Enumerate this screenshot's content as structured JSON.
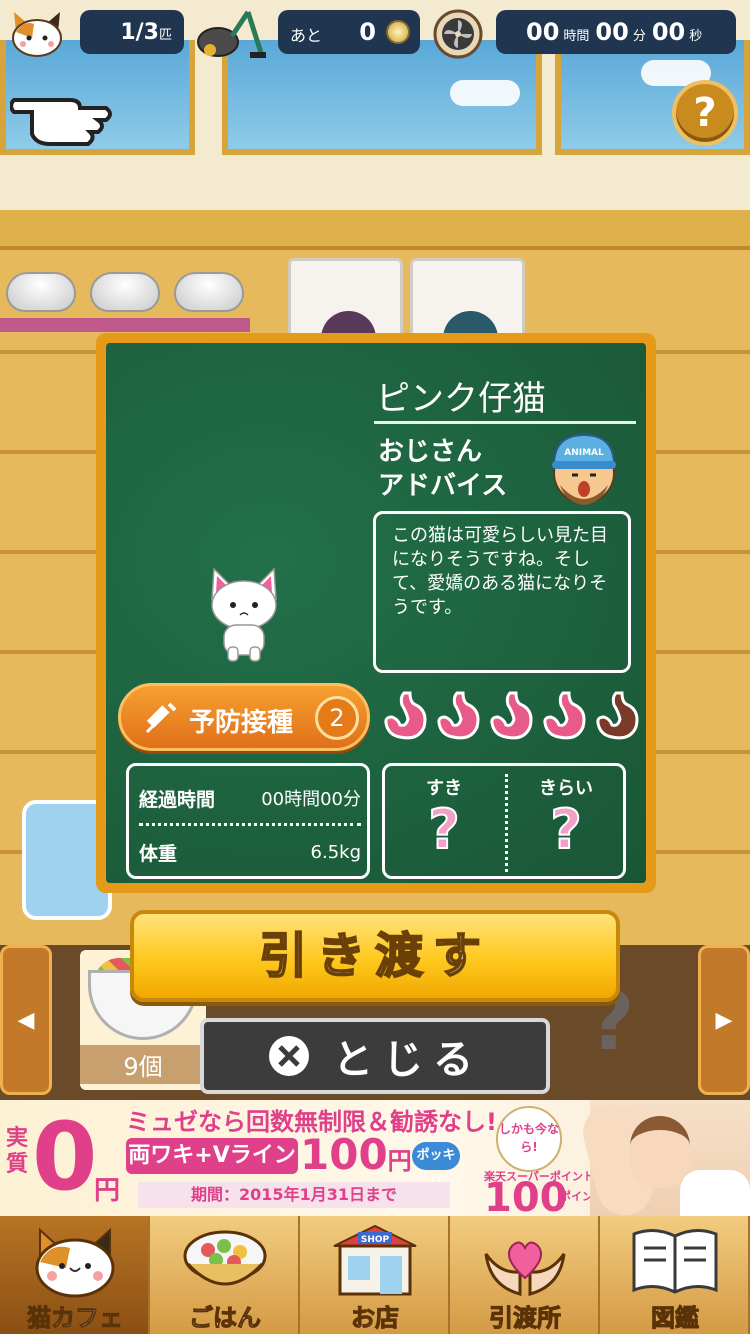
{
  "hud": {
    "cat_count": "1/3",
    "cat_count_unit": "匹",
    "coins_label": "あと",
    "coins_value": "0",
    "timer": {
      "hours": "00",
      "hours_unit": "時間",
      "minutes": "00",
      "minutes_unit": "分",
      "seconds": "00",
      "seconds_unit": "秒"
    },
    "help_label": "?"
  },
  "dialog": {
    "kitten_name": "ピンク仔猫",
    "advice_title_line1": "おじさん",
    "advice_title_line2": "アドバイス",
    "ojisan_cap_text": "ANIMAL",
    "advice_text": "この猫は可愛らしい見た目になりそうですね。そして、愛嬌のある猫になりそうです。",
    "vaccine": {
      "label": "予防接種",
      "count": "2"
    },
    "stomach": {
      "full_color": "#e85a8a",
      "empty_color": "#7a3a2a",
      "total": 5,
      "full": 4
    },
    "stats": {
      "elapsed_label": "経過時間",
      "elapsed_value": "00時間00分",
      "weight_label": "体重",
      "weight_value": "6.5kg"
    },
    "likes": {
      "like_label": "すき",
      "like_value": "?",
      "dislike_label": "きらい",
      "dislike_value": "?"
    }
  },
  "actions": {
    "handover_label": "引き渡す",
    "close_label": "とじる"
  },
  "food_tray": {
    "left_arrow": "◀",
    "right_arrow": "▶",
    "food_count": "9個",
    "locked_label": "?"
  },
  "ad": {
    "headline": "ミュゼなら回数無制限＆勧誘なし!",
    "jisshitsu": "実質",
    "zero": "0",
    "yen": "円",
    "plan": "両ワキ+Vライン",
    "price": "100",
    "price_unit": "円",
    "tag": "ポッキリ",
    "period": "期間：2015年1月31日まで",
    "badge": "しかも今なら!",
    "rakuten": "楽天スーパーポイント",
    "points": "100",
    "points_unit": "ポイント"
  },
  "nav": {
    "items": [
      {
        "label": "猫カフェ",
        "icon": "cat-face-icon",
        "active": true
      },
      {
        "label": "ごはん",
        "icon": "food-bowl-icon",
        "active": false
      },
      {
        "label": "お店",
        "icon": "shop-icon",
        "shop_sign": "SHOP",
        "active": false
      },
      {
        "label": "引渡所",
        "icon": "heart-hands-icon",
        "active": false
      },
      {
        "label": "図鑑",
        "icon": "book-icon",
        "active": false
      }
    ]
  },
  "colors": {
    "board_green": "#1b5e3a",
    "frame_orange": "#e59a1a",
    "accent_pink": "#e0408a",
    "button_yellow": "#ffc81e"
  }
}
